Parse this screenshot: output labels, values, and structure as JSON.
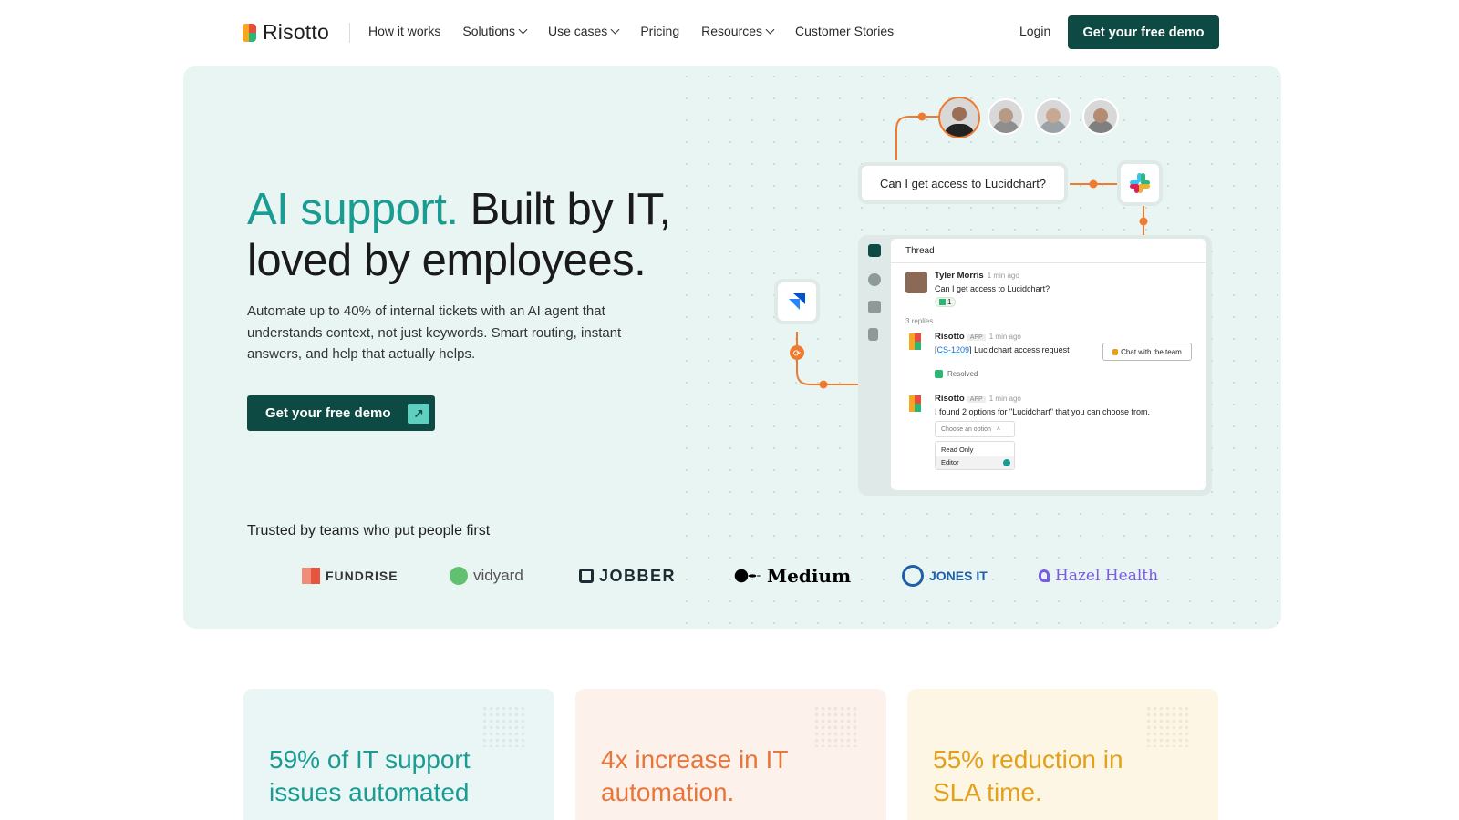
{
  "nav": {
    "brand": "Risotto",
    "links": [
      "How it works",
      "Solutions",
      "Use cases",
      "Pricing",
      "Resources",
      "Customer Stories"
    ],
    "login": "Login",
    "cta": "Get your free demo"
  },
  "hero": {
    "headline_accent": "AI support.",
    "headline_rest_1": " Built by IT,",
    "headline_line_2": "loved by employees.",
    "subtext": "Automate up to 40% of internal tickets with an AI agent that understands context, not just keywords. Smart routing, instant answers, and help that actually helps.",
    "cta": "Get your free demo",
    "trusted": "Trusted by teams who put people first",
    "logos": [
      "FUNDRISE",
      "vidyard",
      "JOBBER",
      "Medium",
      "JONES IT",
      "Hazel Health"
    ]
  },
  "diagram": {
    "question": "Can I get access to Lucidchart?",
    "thread": {
      "title": "Thread",
      "msg1": {
        "name": "Tyler Morris",
        "time": "1 min ago",
        "text": "Can I get access to Lucidchart?",
        "reaction": "1"
      },
      "replies": "3 replies",
      "msg2": {
        "name": "Risotto",
        "tag": "APP",
        "time": "1 min ago",
        "ticket": "CS-1209",
        "text": " Lucidchart access request",
        "button": "Chat with the team",
        "status": "Resolved"
      },
      "msg3": {
        "name": "Risotto",
        "tag": "APP",
        "time": "1 min ago",
        "text": "I found 2 options for \"Lucidchart\" that you can choose from.",
        "select_placeholder": "Choose an option",
        "options": [
          "Read Only",
          "Editor"
        ]
      }
    }
  },
  "stats": [
    {
      "text": "59% of IT support issues automated",
      "color": "#1a9c92",
      "bg": "#eaf6f6"
    },
    {
      "text": "4x increase in IT automation.",
      "color": "#e8763a",
      "bg": "#fdf1eb"
    },
    {
      "text": "55% reduction in SLA time.",
      "color": "#e3a01b",
      "bg": "#fdf6e5"
    }
  ],
  "colors": {
    "brand_dark": "#0e4a44",
    "accent": "#1a9c92",
    "hero_bg": "#e8f5f3",
    "connector": "#ee7b2f"
  }
}
